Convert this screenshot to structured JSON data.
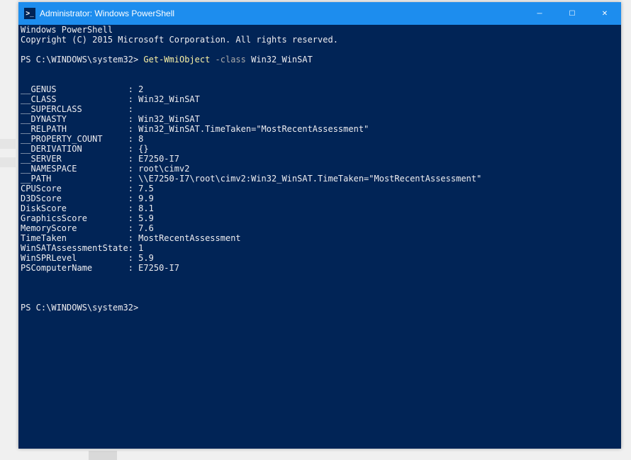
{
  "titlebar": {
    "icon_text": ">_",
    "title": "Administrator: Windows PowerShell",
    "minimize_glyph": "─",
    "maximize_glyph": "☐",
    "close_glyph": "✕"
  },
  "terminal": {
    "header_line1": "Windows PowerShell",
    "header_line2": "Copyright (C) 2015 Microsoft Corporation. All rights reserved.",
    "prompt1_prefix": "PS C:\\WINDOWS\\system32> ",
    "prompt1_cmd": "Get-WmiObject",
    "prompt1_flag": " -class",
    "prompt1_arg": " Win32_WinSAT",
    "properties": [
      {
        "name": "__GENUS",
        "value": "2"
      },
      {
        "name": "__CLASS",
        "value": "Win32_WinSAT"
      },
      {
        "name": "__SUPERCLASS",
        "value": ""
      },
      {
        "name": "__DYNASTY",
        "value": "Win32_WinSAT"
      },
      {
        "name": "__RELPATH",
        "value": "Win32_WinSAT.TimeTaken=\"MostRecentAssessment\""
      },
      {
        "name": "__PROPERTY_COUNT",
        "value": "8"
      },
      {
        "name": "__DERIVATION",
        "value": "{}"
      },
      {
        "name": "__SERVER",
        "value": "E7250-I7"
      },
      {
        "name": "__NAMESPACE",
        "value": "root\\cimv2"
      },
      {
        "name": "__PATH",
        "value": "\\\\E7250-I7\\root\\cimv2:Win32_WinSAT.TimeTaken=\"MostRecentAssessment\""
      },
      {
        "name": "CPUScore",
        "value": "7.5"
      },
      {
        "name": "D3DScore",
        "value": "9.9"
      },
      {
        "name": "DiskScore",
        "value": "8.1"
      },
      {
        "name": "GraphicsScore",
        "value": "5.9"
      },
      {
        "name": "MemoryScore",
        "value": "7.6"
      },
      {
        "name": "TimeTaken",
        "value": "MostRecentAssessment"
      },
      {
        "name": "WinSATAssessmentState",
        "value": "1"
      },
      {
        "name": "WinSPRLevel",
        "value": "5.9"
      },
      {
        "name": "PSComputerName",
        "value": "E7250-I7"
      }
    ],
    "property_name_width": 21,
    "prompt2": "PS C:\\WINDOWS\\system32>"
  }
}
